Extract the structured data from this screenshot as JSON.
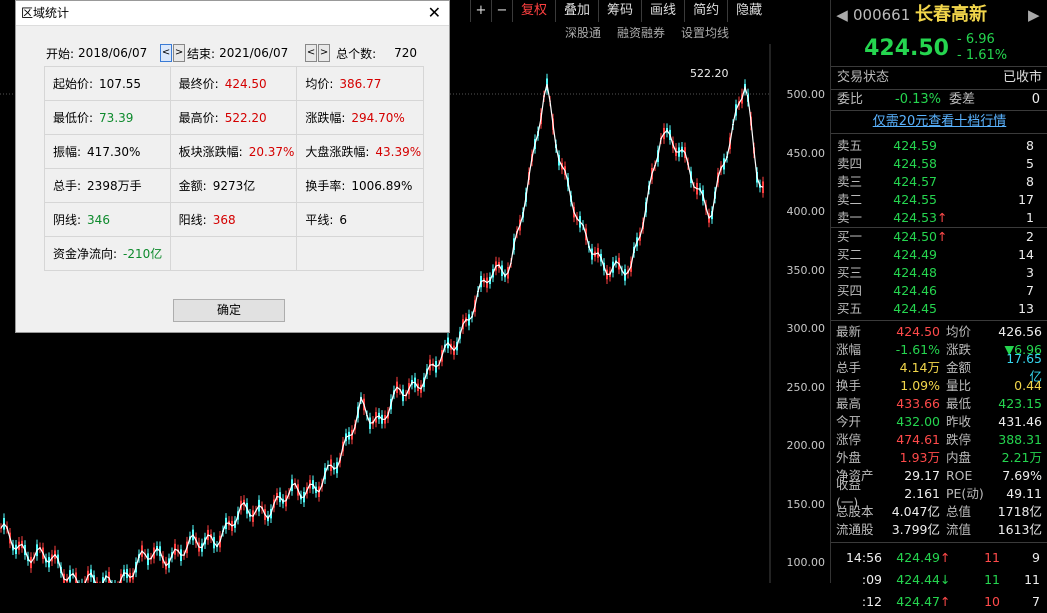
{
  "toolbar": {
    "items": [
      "+",
      "−",
      "复权",
      "叠加",
      "筹码",
      "画线",
      "简约",
      "隐藏"
    ]
  },
  "sublinks": [
    "深股通",
    "融资融券",
    "设置均线"
  ],
  "chart": {
    "y_ticks": [
      "500.00",
      "450.00",
      "400.00",
      "350.00",
      "300.00",
      "250.00",
      "200.00",
      "150.00",
      "100.00"
    ],
    "peak_label": "522.20"
  },
  "stock": {
    "code": "000661",
    "name": "长春高新",
    "price": "424.50",
    "change": "- 6.96",
    "pct": "- 1.61%"
  },
  "status": {
    "label": "交易状态",
    "value": "已收市"
  },
  "weibi": {
    "label1": "委比",
    "value1": "-0.13%",
    "label2": "委差",
    "value2": "0"
  },
  "promo": "仅需20元查看十档行情",
  "asks": [
    {
      "label": "卖五",
      "price": "424.59",
      "vol": "8"
    },
    {
      "label": "卖四",
      "price": "424.58",
      "vol": "5"
    },
    {
      "label": "卖三",
      "price": "424.57",
      "vol": "8"
    },
    {
      "label": "卖二",
      "price": "424.55",
      "vol": "17"
    },
    {
      "label": "卖一",
      "price": "424.53",
      "vol": "1"
    }
  ],
  "bids": [
    {
      "label": "买一",
      "price": "424.50",
      "vol": "2"
    },
    {
      "label": "买二",
      "price": "424.49",
      "vol": "14"
    },
    {
      "label": "买三",
      "price": "424.48",
      "vol": "3"
    },
    {
      "label": "买四",
      "price": "424.46",
      "vol": "7"
    },
    {
      "label": "买五",
      "price": "424.45",
      "vol": "13"
    }
  ],
  "stats": [
    {
      "l1": "最新",
      "v1": "424.50",
      "c1": "red",
      "l2": "均价",
      "v2": "426.56",
      "c2": "white"
    },
    {
      "l1": "涨幅",
      "v1": "-1.61%",
      "c1": "green",
      "l2": "涨跌",
      "v2": "▼6.96",
      "c2": "green"
    },
    {
      "l1": "总手",
      "v1": "4.14万",
      "c1": "yellow",
      "l2": "金额",
      "v2": "17.65亿",
      "c2": "cyan"
    },
    {
      "l1": "换手",
      "v1": "1.09%",
      "c1": "yellow",
      "l2": "量比",
      "v2": "0.44",
      "c2": "yellow"
    },
    {
      "l1": "最高",
      "v1": "433.66",
      "c1": "red",
      "l2": "最低",
      "v2": "423.15",
      "c2": "green"
    },
    {
      "l1": "今开",
      "v1": "432.00",
      "c1": "green",
      "l2": "昨收",
      "v2": "431.46",
      "c2": "white"
    },
    {
      "l1": "涨停",
      "v1": "474.61",
      "c1": "red",
      "l2": "跌停",
      "v2": "388.31",
      "c2": "green"
    },
    {
      "l1": "外盘",
      "v1": "1.93万",
      "c1": "red",
      "l2": "内盘",
      "v2": "2.21万",
      "c2": "green"
    },
    {
      "l1": "净资产",
      "v1": "29.17",
      "c1": "white",
      "l2": "ROE",
      "v2": "7.69%",
      "c2": "white"
    },
    {
      "l1": "收益(一)",
      "v1": "2.161",
      "c1": "white",
      "l2": "PE(动)",
      "v2": "49.11",
      "c2": "white"
    },
    {
      "l1": "总股本",
      "v1": "4.047亿",
      "c1": "white",
      "l2": "总值",
      "v2": "1718亿",
      "c2": "white"
    },
    {
      "l1": "流通股",
      "v1": "3.799亿",
      "c1": "white",
      "l2": "流值",
      "v2": "1613亿",
      "c2": "white"
    }
  ],
  "ticks": [
    {
      "time": "14:56",
      "price": "424.49",
      "dir": "up",
      "vol": "11",
      "num": "9"
    },
    {
      "time": ":09",
      "price": "424.44",
      "dir": "down",
      "vol": "11",
      "num": "11"
    },
    {
      "time": ":12",
      "price": "424.47",
      "dir": "up",
      "vol": "10",
      "num": "7"
    }
  ],
  "dialog": {
    "title": "区域统计",
    "start_label": "开始:",
    "start": "2018/06/07",
    "end_label": "结束:",
    "end": "2021/06/07",
    "count_label": "总个数:",
    "count": "720",
    "rows": [
      [
        {
          "l": "起始价:",
          "v": "107.55",
          "c": "vk"
        },
        {
          "l": "最终价:",
          "v": "424.50",
          "c": "vr"
        },
        {
          "l": "均价:",
          "v": "386.77",
          "c": "vr"
        }
      ],
      [
        {
          "l": "最低价:",
          "v": "73.39",
          "c": "vg"
        },
        {
          "l": "最高价:",
          "v": "522.20",
          "c": "vr"
        },
        {
          "l": "涨跌幅:",
          "v": "294.70%",
          "c": "vr"
        }
      ],
      [
        {
          "l": "振幅:",
          "v": "417.30%",
          "c": "vk"
        },
        {
          "l": "板块涨跌幅:",
          "v": "20.37%",
          "c": "vr"
        },
        {
          "l": "大盘涨跌幅:",
          "v": "43.39%",
          "c": "vr"
        }
      ],
      [
        {
          "l": "总手:",
          "v": "2398万手",
          "c": "vk"
        },
        {
          "l": "金额:",
          "v": "9273亿",
          "c": "vk"
        },
        {
          "l": "换手率:",
          "v": "1006.89%",
          "c": "vk"
        }
      ],
      [
        {
          "l": "阴线:",
          "v": "346",
          "c": "vg"
        },
        {
          "l": "阳线:",
          "v": "368",
          "c": "vr"
        },
        {
          "l": "平线:",
          "v": "6",
          "c": "vk"
        }
      ],
      [
        {
          "l": "资金净流向:",
          "v": "-210亿",
          "c": "vg"
        },
        {
          "l": "",
          "v": "",
          "c": "vk"
        },
        {
          "l": "",
          "v": "",
          "c": "vk"
        }
      ]
    ],
    "ok": "确定"
  }
}
